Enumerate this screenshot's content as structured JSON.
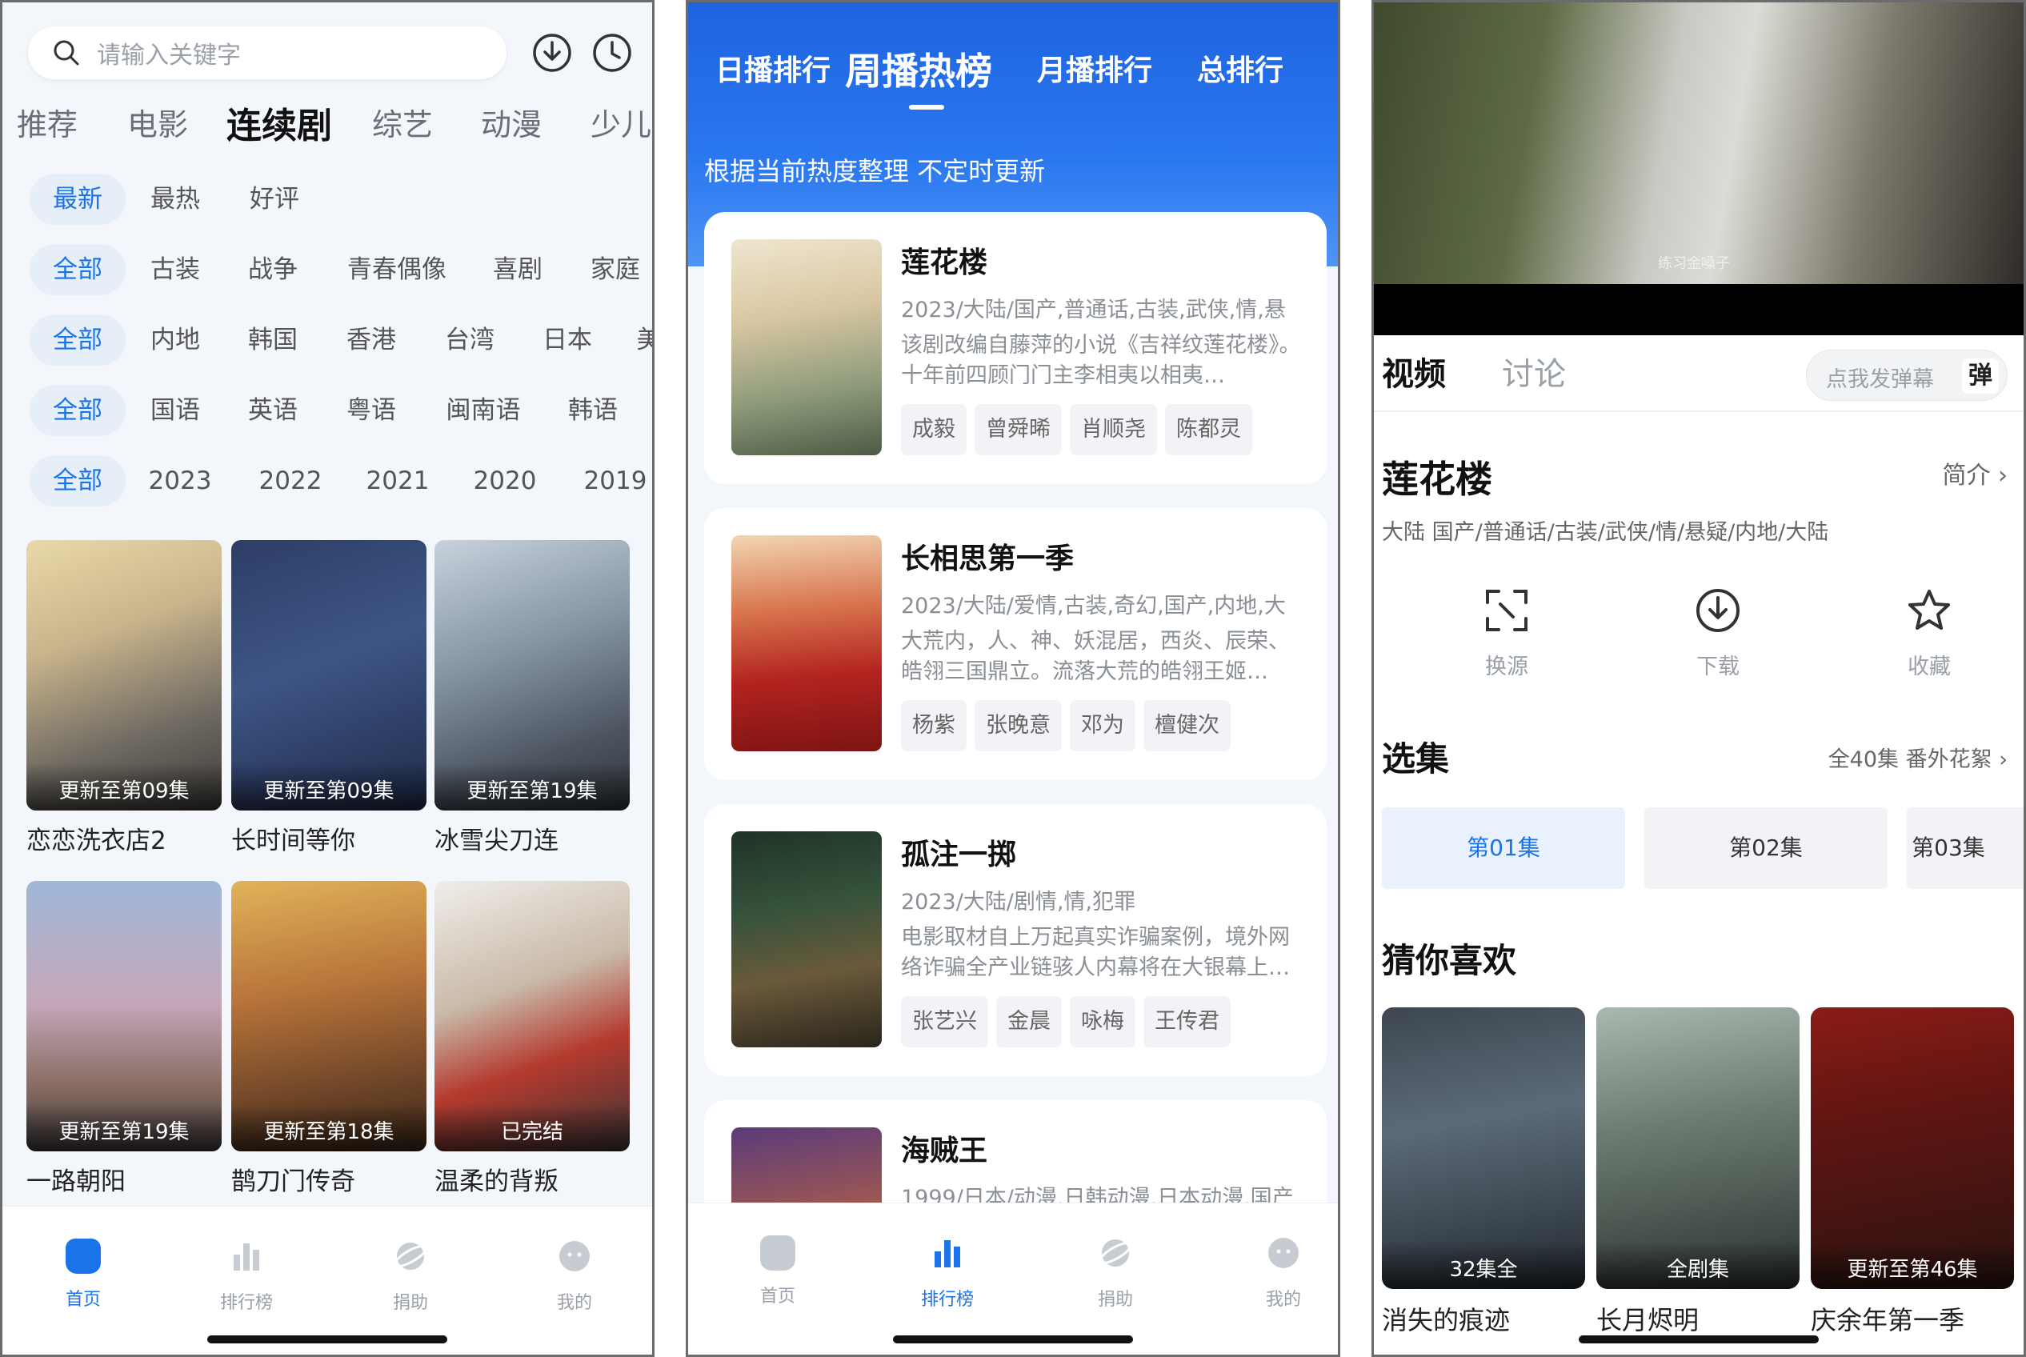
{
  "phone1": {
    "search": {
      "placeholder": "请输入关键字"
    },
    "categories": [
      "推荐",
      "电影",
      "连续剧",
      "综艺",
      "动漫",
      "少儿"
    ],
    "sort_filters": [
      "最新",
      "最热",
      "好评"
    ],
    "genre_filters": [
      "全部",
      "古装",
      "战争",
      "青春偶像",
      "喜剧",
      "家庭"
    ],
    "region_filters": [
      "全部",
      "内地",
      "韩国",
      "香港",
      "台湾",
      "日本",
      "美"
    ],
    "language_filters": [
      "全部",
      "国语",
      "英语",
      "粤语",
      "闽南语",
      "韩语"
    ],
    "year_filters": [
      "全部",
      "2023",
      "2022",
      "2021",
      "2020",
      "2019"
    ],
    "shows": [
      {
        "title": "恋恋洗衣店2",
        "badge": "更新至第09集"
      },
      {
        "title": "长时间等你",
        "badge": "更新至第09集"
      },
      {
        "title": "冰雪尖刀连",
        "badge": "更新至第19集"
      },
      {
        "title": "一路朝阳",
        "badge": "更新至第19集"
      },
      {
        "title": "鹊刀门传奇",
        "badge": "更新至第18集"
      },
      {
        "title": "温柔的背叛",
        "badge": "已完结"
      }
    ],
    "tabbar": [
      "首页",
      "排行榜",
      "捐助",
      "我的"
    ]
  },
  "phone2": {
    "rank_tabs": [
      "日播排行",
      "周播热榜",
      "月播排行",
      "总排行"
    ],
    "subtitle": "根据当前热度整理 不定时更新",
    "rank_items": [
      {
        "title": "莲花楼",
        "meta": "2023/大陆/国产,普通话,古装,武侠,情,悬",
        "desc": "该剧改编自藤萍的小说《吉祥纹莲花楼》。十年前四顾门门主李相夷以相夷…",
        "actors": [
          "成毅",
          "曾舜晞",
          "肖顺尧",
          "陈都灵"
        ]
      },
      {
        "title": "长相思第一季",
        "meta": "2023/大陆/爱情,古装,奇幻,国产,内地,大",
        "desc": "大荒内，人、神、妖混居，西炎、辰荣、皓翎三国鼎立。流落大荒的皓翎王姬…",
        "actors": [
          "杨紫",
          "张晚意",
          "邓为",
          "檀健次"
        ]
      },
      {
        "title": "孤注一掷",
        "meta": "2023/大陆/剧情,情,犯罪",
        "desc": "电影取材自上万起真实诈骗案例，境外网络诈骗全产业链骇人内幕将在大银幕上…",
        "actors": [
          "张艺兴",
          "金晨",
          "咏梅",
          "王传君"
        ]
      },
      {
        "title": "海贼王",
        "meta": "1999/日本/动漫,日韩动漫,日本动漫,国产",
        "desc": "",
        "actors": []
      }
    ],
    "tabbar": [
      "首页",
      "排行榜",
      "捐助",
      "我的"
    ]
  },
  "phone3": {
    "video_watermark": "练习金嗓子",
    "tabs": [
      "视频",
      "讨论"
    ],
    "danmu_placeholder": "点我发弹幕",
    "danmu_button": "弹",
    "title": "莲花楼",
    "intro_link": "简介",
    "tags": "大陆  国产/普通话/古装/武侠/情/悬疑/内地/大陆",
    "actions": [
      "换源",
      "下载",
      "收藏"
    ],
    "episodes_title": "选集",
    "episodes_info": "全40集 番外花絮",
    "episodes": [
      "第01集",
      "第02集",
      "第03集"
    ],
    "recommend_title": "猜你喜欢",
    "recommend": [
      {
        "title": "消失的痕迹",
        "badge": "32集全"
      },
      {
        "title": "长月烬明",
        "badge": "全剧集"
      },
      {
        "title": "庆余年第一季",
        "badge": "更新至第46集"
      }
    ]
  },
  "colors": {
    "accent": "#1a73e8",
    "rank_header": "#1e64e0"
  }
}
